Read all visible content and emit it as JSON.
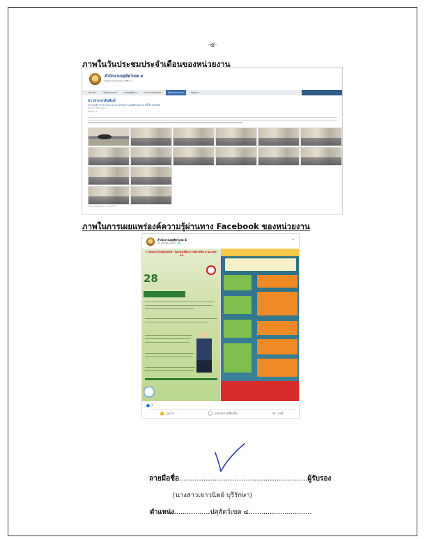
{
  "page": {
    "number": "-๕-",
    "heading_meeting": "ภาพในวันประชุมประจำเดือนของหน่วยงาน",
    "heading_facebook": "ภาพในการเผยแพร่องค์ความรู้ผ่านทาง Facebook ของหน่วยงาน"
  },
  "website": {
    "org_name": "สำนักงานปศุสัตว์เขต ๔",
    "org_subtitle": "Regional Livestock Office 4",
    "nav_items": [
      "หน้าแรก",
      "ข้อมูลหน่วยงาน",
      "แผนปฏิบัติการ",
      "ข่าวประชาสัมพันธ์",
      "กิจกรรมหน่วยงาน",
      "ติดต่อเรา"
    ],
    "active_nav_index": 4,
    "section": "ข่าวประชาสัมพันธ์",
    "article_title": "ประชุมข้าราชการและลูกจ้างสำนักงานปศุสัตว์เขต ๔ ครั้งที่ 3/2569",
    "meta_author": "สำนักงานปศุสัตว์เขต ๔",
    "meta_views": "ผู้เข้าชม 12",
    "footer_text": "สำนักงานปศุสัตว์เขต ๔ | กรมปศุสัตว์"
  },
  "facebook": {
    "page_name": "สำนักงานปศุสัตว์เขต 4",
    "date": "19 มีนาคม 2025 · 🌐",
    "more": "···",
    "left_title": "การป้องกันโรคพิษสุนัขบ้า ป้องกันได้ด้วยการฉีดวัคซีน ตามมาตรา 28",
    "left_number": "28",
    "reaction_count": "1",
    "actions": [
      {
        "icon": "like-icon",
        "label": "ถูกใจ"
      },
      {
        "icon": "comment-icon",
        "label": "แสดงความคิดเห็น"
      },
      {
        "icon": "share-icon",
        "label": "แชร์"
      }
    ]
  },
  "signature": {
    "label": "ลายมือชื่อ",
    "dots": "..........................................................",
    "role": "ผู้รับรอง",
    "name": "(นางสาวเยาวนิตย์  บุรีรักษา)",
    "position_label": "ตำแหน่ง",
    "position_dots_before": ".................",
    "position_value": "ปศุสัตว์เขต ๔",
    "position_dots_after": ".............................."
  },
  "colors": {
    "nav_active": "#3d6ab0",
    "brand_blue": "#1a3b78",
    "facebook_blue": "#1877f2",
    "signature_ink": "#2b3aa8"
  }
}
